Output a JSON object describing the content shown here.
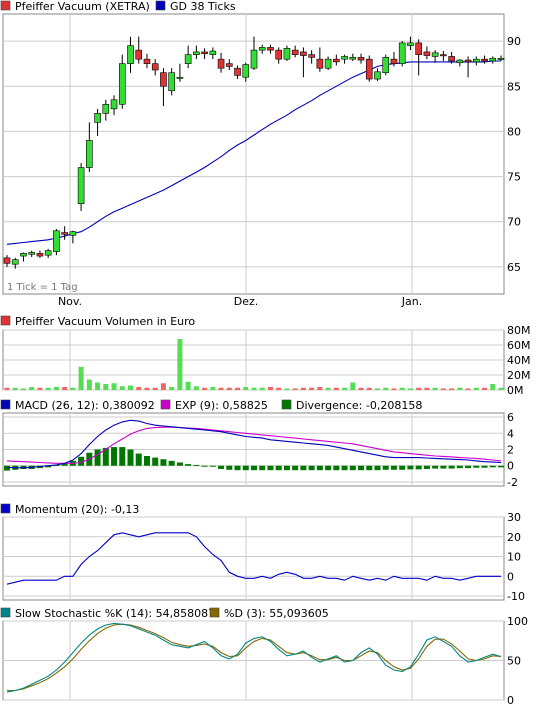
{
  "colors": {
    "up": "#33dd33",
    "down": "#dd3333",
    "gd": "#0000bb",
    "macd": "#0000bb",
    "exp": "#cc00cc",
    "divergence": "#007700",
    "momentum": "#0000cc",
    "stoch_k": "#008888",
    "stoch_d": "#886600",
    "grid": "#cccccc",
    "vol_up": "#55dd55",
    "vol_down": "#ee6666"
  },
  "months": [
    "Nov.",
    "Dez.",
    "Jan."
  ],
  "chart_data": [
    {
      "type": "candlestick",
      "legend": [
        {
          "label": "Pfeiffer Vacuum (XETRA)",
          "color": "#dd3333"
        },
        {
          "label": "GD 38 Ticks",
          "color": "#0000bb"
        }
      ],
      "note": "1 Tick = 1 Tag",
      "ylim": [
        62,
        93
      ],
      "yticks": [
        65,
        70,
        75,
        80,
        85,
        90
      ],
      "ohlc": [
        [
          66.0,
          66.3,
          65.0,
          65.4
        ],
        [
          65.3,
          66.0,
          64.8,
          65.8
        ],
        [
          66.2,
          66.6,
          65.6,
          66.5
        ],
        [
          66.4,
          66.8,
          66.1,
          66.6
        ],
        [
          66.5,
          66.8,
          66.0,
          66.2
        ],
        [
          66.3,
          67.0,
          66.0,
          66.8
        ],
        [
          66.7,
          69.2,
          66.3,
          69.0
        ],
        [
          68.8,
          69.5,
          68.0,
          68.6
        ],
        [
          68.5,
          69.0,
          67.6,
          68.9
        ],
        [
          72.0,
          76.5,
          71.2,
          76.0
        ],
        [
          76.0,
          81.0,
          75.5,
          79.0
        ],
        [
          81.0,
          82.5,
          79.5,
          82.0
        ],
        [
          82.0,
          83.5,
          81.2,
          83.0
        ],
        [
          82.5,
          84.0,
          81.8,
          83.5
        ],
        [
          83.0,
          88.5,
          82.5,
          87.5
        ],
        [
          87.5,
          90.5,
          86.5,
          89.5
        ],
        [
          89.0,
          90.5,
          87.5,
          88.0
        ],
        [
          88.0,
          88.6,
          87.0,
          87.5
        ],
        [
          87.5,
          88.0,
          86.2,
          86.8
        ],
        [
          86.5,
          87.0,
          82.8,
          85.0
        ],
        [
          84.5,
          87.0,
          84.0,
          86.5
        ],
        [
          86.0,
          87.5,
          85.5,
          86.0
        ],
        [
          87.5,
          89.5,
          87.0,
          88.5
        ],
        [
          88.5,
          89.5,
          88.0,
          88.8
        ],
        [
          88.8,
          89.2,
          88.0,
          88.6
        ],
        [
          88.5,
          89.3,
          88.0,
          88.9
        ],
        [
          88.0,
          88.7,
          86.5,
          87.0
        ],
        [
          87.5,
          88.0,
          86.8,
          87.2
        ],
        [
          87.0,
          87.3,
          85.8,
          86.2
        ],
        [
          86.0,
          87.6,
          85.5,
          87.4
        ],
        [
          87.0,
          90.5,
          86.8,
          89.0
        ],
        [
          89.0,
          89.6,
          88.6,
          89.3
        ],
        [
          89.3,
          89.6,
          88.6,
          89.0
        ],
        [
          89.0,
          89.3,
          87.5,
          88.0
        ],
        [
          88.0,
          89.5,
          87.8,
          89.2
        ],
        [
          89.0,
          89.5,
          88.2,
          88.5
        ],
        [
          88.8,
          89.3,
          86.0,
          88.4
        ],
        [
          88.5,
          89.0,
          87.5,
          88.2
        ],
        [
          88.0,
          89.3,
          86.6,
          87.0
        ],
        [
          87.0,
          88.3,
          86.8,
          88.0
        ],
        [
          88.0,
          88.5,
          87.3,
          87.7
        ],
        [
          88.0,
          88.5,
          87.5,
          88.3
        ],
        [
          88.0,
          88.6,
          87.8,
          88.2
        ],
        [
          88.2,
          88.6,
          87.5,
          87.9
        ],
        [
          88.0,
          88.4,
          85.5,
          85.8
        ],
        [
          85.8,
          87.0,
          85.6,
          86.6
        ],
        [
          86.5,
          88.5,
          86.2,
          88.2
        ],
        [
          88.0,
          88.8,
          87.2,
          87.5
        ],
        [
          87.5,
          90.0,
          87.2,
          89.8
        ],
        [
          89.5,
          90.5,
          89.0,
          89.8
        ],
        [
          89.8,
          90.2,
          86.2,
          88.5
        ],
        [
          88.8,
          89.4,
          88.0,
          88.4
        ],
        [
          88.3,
          89.0,
          87.6,
          88.7
        ],
        [
          88.5,
          88.9,
          87.8,
          88.4
        ],
        [
          88.3,
          88.8,
          87.5,
          87.8
        ],
        [
          87.6,
          88.0,
          87.2,
          87.9
        ],
        [
          87.9,
          88.3,
          86.0,
          87.7
        ],
        [
          87.7,
          88.3,
          87.3,
          88.0
        ],
        [
          88.0,
          88.4,
          87.5,
          87.8
        ],
        [
          87.8,
          88.3,
          87.5,
          88.1
        ],
        [
          88.0,
          88.4,
          87.8,
          88.1
        ]
      ],
      "gd38": [
        67.5,
        67.6,
        67.7,
        67.8,
        67.9,
        68.0,
        68.2,
        68.4,
        68.7,
        68.9,
        69.4,
        70.0,
        70.6,
        71.1,
        71.5,
        71.9,
        72.3,
        72.7,
        73.1,
        73.5,
        74.0,
        74.5,
        75.0,
        75.5,
        76.0,
        76.6,
        77.2,
        77.9,
        78.5,
        79.0,
        79.6,
        80.2,
        80.8,
        81.3,
        81.8,
        82.4,
        82.9,
        83.4,
        84.0,
        84.5,
        85.0,
        85.5,
        86.0,
        86.4,
        86.8,
        87.2,
        87.4,
        87.5,
        87.6,
        87.7,
        87.7,
        87.7,
        87.7,
        87.7,
        87.7,
        87.7,
        87.7,
        87.7,
        87.7,
        87.8,
        87.8
      ]
    },
    {
      "type": "bar",
      "legend": [
        {
          "label": "Pfeiffer Vacuum Volumen in Euro",
          "color": "#dd3333"
        }
      ],
      "ylim": [
        0,
        80
      ],
      "yticks": [
        0,
        20,
        40,
        60,
        80
      ],
      "yticklabels": [
        "0M",
        "20M",
        "40M",
        "60M",
        "80M"
      ],
      "values": [
        3,
        3,
        2,
        4,
        3,
        3,
        4,
        4,
        3,
        31,
        14,
        10,
        8,
        9,
        5,
        6,
        4,
        3,
        3,
        9,
        4,
        68,
        11,
        5,
        3,
        4,
        3,
        3,
        3,
        4,
        3,
        3,
        4,
        3,
        2,
        2,
        3,
        3,
        4,
        3,
        3,
        3,
        10,
        3,
        3,
        2,
        3,
        2,
        3,
        2,
        3,
        3,
        3,
        2,
        2,
        3,
        2,
        3,
        3,
        8,
        3
      ]
    },
    {
      "type": "line",
      "legend": [
        {
          "label": "MACD (26, 12): 0,380092",
          "color": "#0000bb"
        },
        {
          "label": "EXP (9): 0,58825",
          "color": "#cc00cc"
        },
        {
          "label": "Divergence: -0,208158",
          "color": "#007700"
        }
      ],
      "ylim": [
        -2.5,
        6.5
      ],
      "yticks": [
        -2,
        0,
        2,
        4,
        6
      ],
      "macd": [
        -0.2,
        -0.25,
        -0.25,
        -0.2,
        -0.1,
        0.0,
        0.1,
        0.3,
        0.7,
        1.5,
        2.6,
        3.6,
        4.4,
        5.0,
        5.4,
        5.6,
        5.5,
        5.2,
        5.0,
        4.9,
        4.8,
        4.7,
        4.6,
        4.5,
        4.4,
        4.3,
        4.2,
        4.0,
        3.8,
        3.6,
        3.5,
        3.4,
        3.2,
        3.1,
        3.0,
        2.9,
        2.8,
        2.7,
        2.6,
        2.5,
        2.3,
        2.1,
        1.9,
        1.7,
        1.5,
        1.3,
        1.1,
        1.0,
        1.0,
        1.0,
        1.0,
        0.95,
        0.9,
        0.85,
        0.8,
        0.75,
        0.7,
        0.6,
        0.5,
        0.45,
        0.4
      ],
      "exp": [
        0.6,
        0.55,
        0.5,
        0.45,
        0.4,
        0.35,
        0.3,
        0.3,
        0.3,
        0.4,
        0.8,
        1.4,
        2.0,
        2.7,
        3.3,
        3.9,
        4.3,
        4.6,
        4.7,
        4.75,
        4.75,
        4.7,
        4.65,
        4.6,
        4.5,
        4.4,
        4.3,
        4.2,
        4.1,
        4.0,
        3.9,
        3.8,
        3.7,
        3.6,
        3.5,
        3.4,
        3.3,
        3.2,
        3.1,
        3.0,
        2.9,
        2.8,
        2.7,
        2.5,
        2.3,
        2.1,
        1.9,
        1.7,
        1.6,
        1.5,
        1.4,
        1.3,
        1.2,
        1.15,
        1.1,
        1.0,
        0.95,
        0.9,
        0.8,
        0.7,
        0.6
      ],
      "divergence": [
        -0.6,
        -0.5,
        -0.4,
        -0.4,
        -0.3,
        -0.2,
        0.1,
        0.3,
        0.6,
        1.1,
        1.6,
        2.0,
        2.2,
        2.3,
        2.3,
        2.0,
        1.5,
        1.2,
        1.0,
        0.8,
        0.6,
        0.4,
        0.2,
        0.1,
        0.0,
        -0.1,
        -0.4,
        -0.5,
        -0.55,
        -0.55,
        -0.55,
        -0.55,
        -0.55,
        -0.55,
        -0.55,
        -0.55,
        -0.55,
        -0.55,
        -0.55,
        -0.55,
        -0.55,
        -0.55,
        -0.55,
        -0.55,
        -0.55,
        -0.55,
        -0.5,
        -0.5,
        -0.5,
        -0.45,
        -0.45,
        -0.4,
        -0.35,
        -0.35,
        -0.35,
        -0.3,
        -0.3,
        -0.25,
        -0.25,
        -0.2,
        -0.2
      ]
    },
    {
      "type": "line",
      "legend": [
        {
          "label": "Momentum (20): -0,13",
          "color": "#0000cc"
        }
      ],
      "ylim": [
        -12,
        30
      ],
      "yticks": [
        -10,
        0,
        10,
        20,
        30
      ],
      "values": [
        -4,
        -3,
        -2,
        -2,
        -2,
        -2,
        -2,
        0,
        0,
        6,
        10,
        13,
        17,
        21,
        22,
        21,
        20,
        21,
        22,
        22,
        22,
        22,
        22,
        20,
        15,
        11,
        8,
        2,
        0,
        -1,
        -1,
        0,
        -1,
        1,
        2,
        1,
        -1,
        -1,
        0,
        -1,
        -1,
        -2,
        0,
        -1,
        -2,
        -1,
        -2,
        0,
        -1,
        -1,
        -1,
        -2,
        0,
        -1,
        -1,
        -2,
        -1,
        0,
        0,
        0,
        0
      ]
    },
    {
      "type": "line",
      "legend": [
        {
          "label": "Slow Stochastic %K (14): 54,858087",
          "color": "#008888"
        },
        {
          "label": "%D (3): 55,093605",
          "color": "#886600"
        }
      ],
      "ylim": [
        0,
        100
      ],
      "yticks": [
        0,
        50,
        100
      ],
      "k": [
        10,
        12,
        15,
        20,
        25,
        30,
        38,
        48,
        60,
        72,
        82,
        90,
        95,
        97,
        96,
        94,
        90,
        86,
        82,
        76,
        70,
        68,
        66,
        70,
        74,
        66,
        56,
        52,
        58,
        72,
        78,
        80,
        74,
        64,
        56,
        58,
        62,
        54,
        48,
        52,
        56,
        48,
        50,
        60,
        66,
        58,
        44,
        38,
        36,
        42,
        58,
        76,
        80,
        74,
        68,
        56,
        48,
        50,
        54,
        58,
        55
      ],
      "d": [
        12,
        12,
        14,
        18,
        22,
        27,
        34,
        42,
        52,
        64,
        75,
        84,
        91,
        95,
        96,
        95,
        92,
        88,
        84,
        79,
        73,
        70,
        68,
        69,
        71,
        68,
        60,
        55,
        56,
        66,
        74,
        78,
        76,
        68,
        60,
        58,
        60,
        56,
        51,
        51,
        54,
        50,
        50,
        56,
        62,
        60,
        50,
        42,
        38,
        40,
        52,
        68,
        77,
        77,
        71,
        62,
        52,
        50,
        52,
        56,
        55
      ]
    }
  ]
}
